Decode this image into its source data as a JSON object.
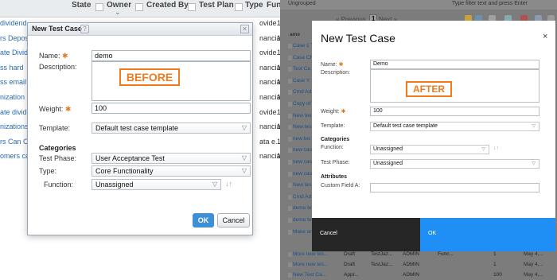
{
  "before": {
    "header": {
      "cols": [
        "State",
        "Owner",
        "Created By",
        "Test Plan",
        "Type",
        "Functio"
      ],
      "chevron": "⌄"
    },
    "rows": [
      {
        "name": "dividend",
        "prov": "ovide...",
        "one": "1"
      },
      {
        "name": "rs Depos",
        "prov": "nancial",
        "one": "1"
      },
      {
        "name": "ate Divid",
        "prov": "ovide...",
        "one": "1"
      },
      {
        "name": "ss hard",
        "prov": "nancial",
        "one": "1"
      },
      {
        "name": "ss email",
        "prov": "nancial",
        "one": "1"
      },
      {
        "name": "nization",
        "prov": "nancial",
        "one": "1"
      },
      {
        "name": "ate divide",
        "prov": "ovide...",
        "one": "1"
      },
      {
        "name": "nizations",
        "prov": "nancial",
        "one": "1"
      },
      {
        "name": "rs Can C",
        "prov": "ata e...",
        "one": "1"
      },
      {
        "name": "omers ca",
        "prov": "nancial",
        "one": "1"
      }
    ],
    "dialog": {
      "title": "New Test Case",
      "help": "?",
      "close": "✕",
      "name_label": "Name:",
      "required_mark": "✱",
      "name_value": "demo",
      "description_label": "Description:",
      "tag": "BEFORE",
      "weight_label": "Weight:",
      "weight_value": "100",
      "template_label": "Template:",
      "template_value": "Default test case template",
      "categories_heading": "Categories",
      "phase_label": "Test Phase:",
      "phase_value": "User Acceptance Test",
      "type_label": "Type:",
      "type_value": "Core Functionality",
      "function_label": "Function:",
      "function_value": "Unassigned",
      "sort_glyph": "↓↑",
      "ok": "OK",
      "cancel": "Cancel"
    }
  },
  "after": {
    "top": {
      "group": "Ungrouped",
      "filter_placeholder": "Type filter text and press Enter"
    },
    "pager": {
      "prev": "« Previous",
      "page": "1",
      "next": "Next »"
    },
    "col_name": "ame",
    "col_modified": "odified",
    "rows": [
      {
        "name": "Case 1 T",
        "mod": "May 4,..."
      },
      {
        "name": "Case Ch",
        "mod": "yester..."
      },
      {
        "name": "Test Ca",
        "mod": "r 8,..."
      },
      {
        "name": "Case Y",
        "mod": "r 8,..."
      },
      {
        "name": "Cmd Ad",
        "mod": "y 4,..."
      },
      {
        "name": "Copy of",
        "mod": "r 20..."
      },
      {
        "name": "New tes",
        "mod": "y 4,..."
      },
      {
        "name": "New tes",
        "mod": "y 4,..."
      },
      {
        "name": "new tes",
        "mod": "y 1,..."
      },
      {
        "name": "new cas",
        "mod": "y 5,..."
      },
      {
        "name": "new cas",
        "mod": "y 1,..."
      },
      {
        "name": "new cas",
        "mod": "y 4,..."
      },
      {
        "name": "New tes",
        "mod": "y 4,..."
      },
      {
        "name": "Cmd Ad",
        "mod": "y 4,..."
      },
      {
        "name": "demo te",
        "mod": "y 4,..."
      },
      {
        "name": "demo te",
        "mod": "y 4,..."
      },
      {
        "name": "Make ar",
        "mod": "y 4,..."
      }
    ],
    "bottom_rows": [
      {
        "name": "More new tes...",
        "state": "Draft",
        "owner": "TestJaz...",
        "created": "ADMIN",
        "func": "Func...",
        "weight": "1",
        "mod": "May 4,..."
      },
      {
        "name": "More new tes...",
        "state": "Draft",
        "owner": "TestJaz...",
        "created": "ADMIN",
        "func": "",
        "weight": "1",
        "mod": "May 4,..."
      },
      {
        "name": "New Test Ca...",
        "state": "Appr...",
        "owner": "",
        "created": "ADMIN",
        "func": "",
        "weight": "100",
        "mod": "May 4,..."
      }
    ],
    "dialog": {
      "title": "New Test Case",
      "close": "×",
      "name_label": "Name:",
      "required_mark": "✱",
      "name_value": "Demo",
      "description_label": "Description:",
      "tag": "AFTER",
      "weight_label": "Weight:",
      "weight_value": "100",
      "template_label": "Template:",
      "template_value": "Default test case template",
      "categories_heading": "Categories",
      "function_label": "Function:",
      "function_value": "Unassigned",
      "sort_glyph": "↓↑",
      "phase_label": "Test Phase:",
      "phase_value": "Unassigned",
      "attributes_heading": "Attributes",
      "custom_label": "Custom Field A:",
      "custom_value": "",
      "cancel": "Cancel",
      "ok": "OK"
    }
  }
}
